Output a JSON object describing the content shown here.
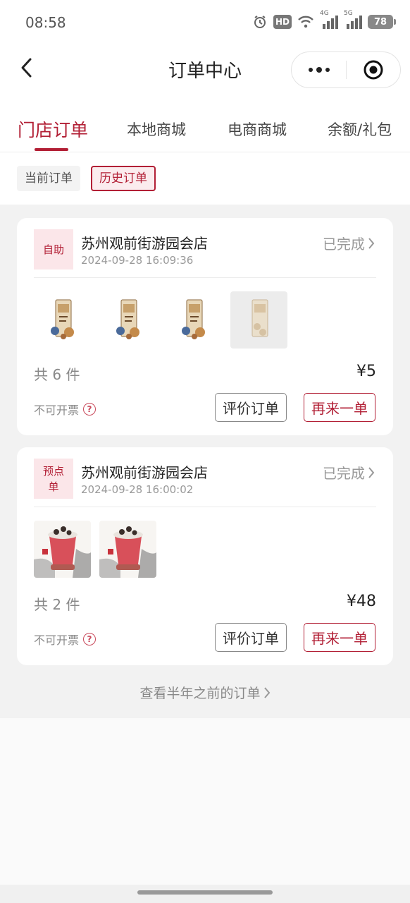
{
  "status_bar": {
    "time": "08:58",
    "hd": "HD",
    "network_4g": "4G",
    "network_5g": "5G",
    "battery": "78"
  },
  "nav": {
    "title": "订单中心"
  },
  "tabs": [
    {
      "label": "门店订单",
      "active": true
    },
    {
      "label": "本地商城",
      "active": false
    },
    {
      "label": "电商商城",
      "active": false
    },
    {
      "label": "余额/礼包",
      "active": false
    }
  ],
  "filters": {
    "current": "当前订单",
    "history": "历史订单"
  },
  "orders": [
    {
      "badge": "自助",
      "store": "苏州观前街游园会店",
      "time": "2024-09-28 16:09:36",
      "status": "已完成",
      "count": "共 6 件",
      "price": "¥5",
      "invoice": "不可开票",
      "review": "评价订单",
      "reorder": "再来一单"
    },
    {
      "badge": "预点单",
      "store": "苏州观前街游园会店",
      "time": "2024-09-28 16:00:02",
      "status": "已完成",
      "count": "共 2 件",
      "price": "¥48",
      "invoice": "不可开票",
      "review": "评价订单",
      "reorder": "再来一单"
    }
  ],
  "more_link": "查看半年之前的订单",
  "colors": {
    "brand": "#b21f35",
    "badge_bg": "#fbe6e9"
  }
}
